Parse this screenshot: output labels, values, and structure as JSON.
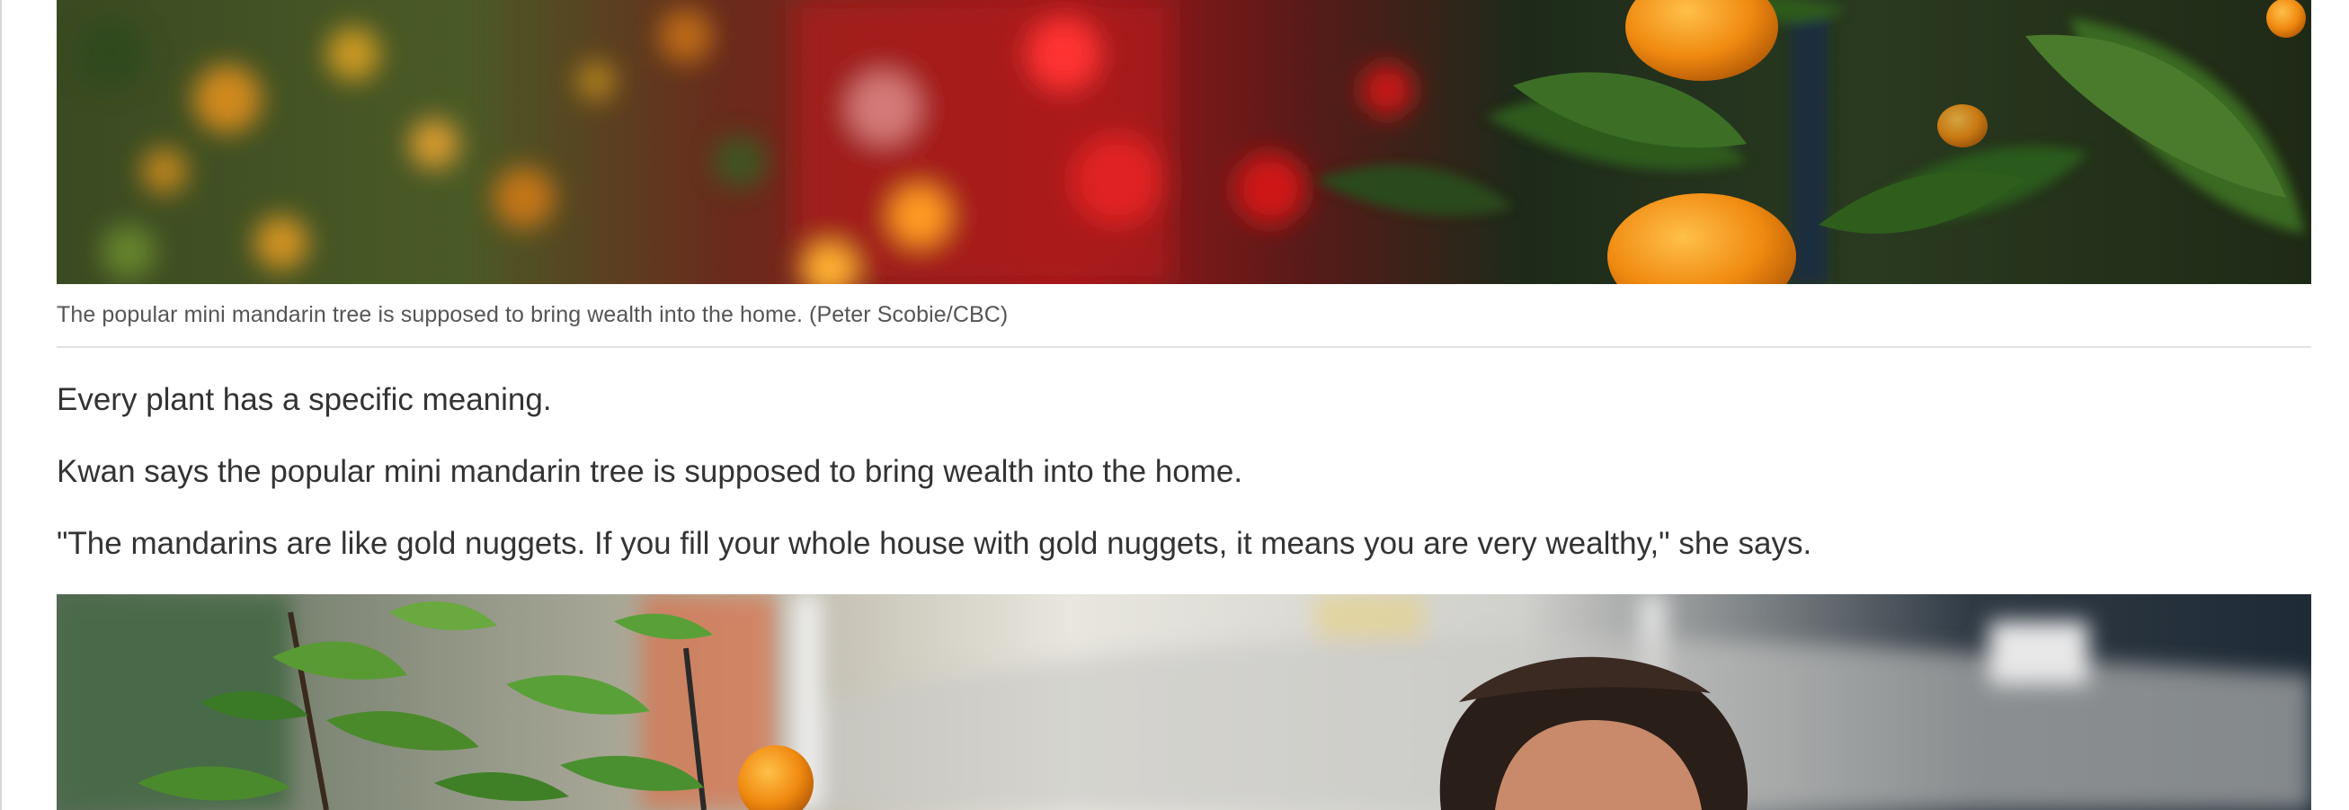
{
  "article": {
    "photo_top": {
      "image": "mandarin-tree-photo"
    },
    "caption": "The popular mini mandarin tree is supposed to bring wealth into the home. (Peter Scobie/CBC)",
    "paragraphs": [
      "Every plant has a specific meaning.",
      "Kwan says the popular mini mandarin tree is supposed to bring wealth into the home.",
      "\"The mandarins are like gold nuggets. If you fill your whole house with gold nuggets, it means you are very wealthy,\" she says."
    ],
    "photo_bottom": {
      "image": "woman-with-mandarin-plants-photo"
    }
  },
  "colors": {
    "text": "#333333",
    "caption_text": "#555555",
    "rule": "#e2e2e2",
    "background": "#ffffff"
  }
}
